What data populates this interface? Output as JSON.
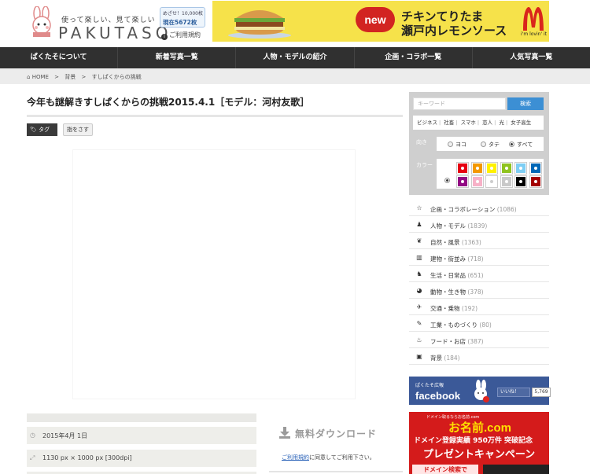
{
  "header": {
    "tagline": "使って楽しい、見て楽しい",
    "brand": "PAKUTASO",
    "goal_line1": "めざせ！10,000枚",
    "goal_line2": "現在5672枚",
    "terms_label": "ご利用規約",
    "ad": {
      "badge": "new",
      "line1": "チキンてりたま",
      "line2": "瀬戸内レモンソース",
      "mc_text": "i'm lovin' it"
    }
  },
  "nav": {
    "items": [
      {
        "label": "ぱくたそについて"
      },
      {
        "label": "新着写真一覧"
      },
      {
        "label": "人物・モデルの紹介"
      },
      {
        "label": "企画・コラボ一覧"
      },
      {
        "label": "人気写真一覧"
      }
    ]
  },
  "breadcrumb": {
    "home": "HOME",
    "sep": ">",
    "level1": "背景",
    "level2": "すしぱくからの挑戦"
  },
  "main": {
    "title": "今年も謎解きすしぱくからの挑戦2015.4.1［モデル：河村友歌］",
    "tag_label": "タグ",
    "tag_chip": "指をさす",
    "meta": {
      "date": "2015年4月 1日",
      "size": "1130 px × 1000 px [300dpi]"
    },
    "download": {
      "title": "無料ダウンロード",
      "terms_link": "ご利用規約",
      "terms_rest": "に同意してご利用下さい。"
    }
  },
  "sidebar": {
    "search_placeholder": "キーワード",
    "search_button": "検索",
    "categories": [
      "ビジネス",
      "社畜",
      "スマホ",
      "恋人",
      "光",
      "女子高生"
    ],
    "orientation_label": "向き",
    "orientation_options": [
      "ヨコ",
      "タテ",
      "すべて"
    ],
    "orientation_selected": "すべて",
    "color_label": "カラー",
    "colors": [
      "#e60012",
      "#f39800",
      "#fff100",
      "#8fc31f",
      "#7ecef4",
      "#0068b7",
      "#920783",
      "#f7b1c7",
      "#ffffff",
      "#c9c9c9",
      "#000000",
      "#a40000"
    ],
    "cat_list": [
      {
        "icon": "star-icon",
        "glyph": "☆",
        "label": "企画・コラボレーション",
        "count": "(1086)"
      },
      {
        "icon": "person-icon",
        "glyph": "♟",
        "label": "人物・モデル",
        "count": "(1839)"
      },
      {
        "icon": "leaf-icon",
        "glyph": "❦",
        "label": "自然・風景",
        "count": "(1363)"
      },
      {
        "icon": "building-icon",
        "glyph": "▥",
        "label": "建物・街並み",
        "count": "(718)"
      },
      {
        "icon": "people-icon",
        "glyph": "♞",
        "label": "生活・日常品",
        "count": "(651)"
      },
      {
        "icon": "globe-icon",
        "glyph": "◕",
        "label": "動物・生き物",
        "count": "(378)"
      },
      {
        "icon": "plane-icon",
        "glyph": "✈",
        "label": "交通・乗物",
        "count": "(192)"
      },
      {
        "icon": "wrench-icon",
        "glyph": "✎",
        "label": "工業・ものづくり",
        "count": "(80)"
      },
      {
        "icon": "cutlery-icon",
        "glyph": "♨",
        "label": "フード・お店",
        "count": "(387)"
      },
      {
        "icon": "picture-icon",
        "glyph": "▣",
        "label": "背景",
        "count": "(184)"
      }
    ],
    "facebook": {
      "small": "ぱくたそ広報",
      "word": "facebook",
      "like": "いいね！",
      "count": "5,769"
    },
    "red_ad": {
      "line1": "ドメイン取るならお名前.com",
      "line2": "お名前.com",
      "line3": "ドメイン登録実績 950万件 突破記念",
      "line4": "プレゼントキャンペーン",
      "line5": "ドメイン検索で"
    }
  }
}
